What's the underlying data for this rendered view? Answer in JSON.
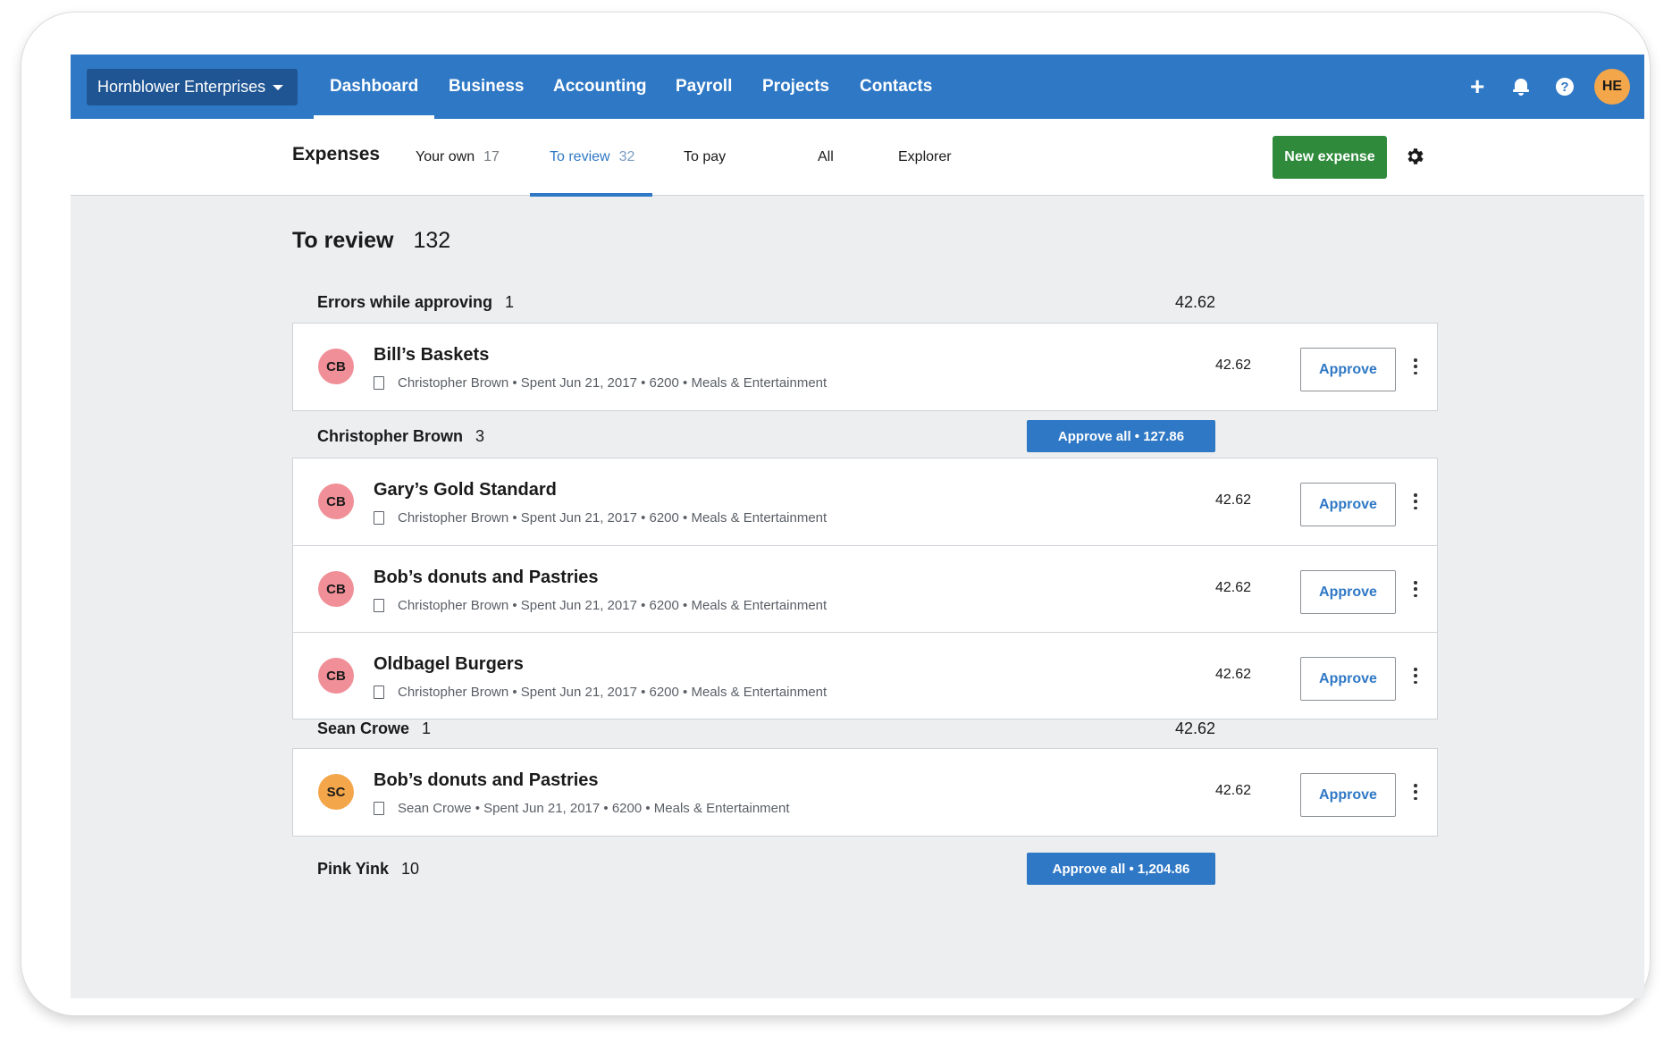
{
  "colors": {
    "nav_bg": "#2f78c5",
    "org_bg": "#1f5593",
    "primary": "#2f78c5",
    "success": "#2f8a3b",
    "avatar_cb": "#f08f97",
    "avatar_sc": "#f4a64a",
    "avatar_he": "#f4a64a"
  },
  "topnav": {
    "org_name": "Hornblower Enterprises",
    "items": [
      {
        "label": "Dashboard",
        "active": true
      },
      {
        "label": "Business"
      },
      {
        "label": "Accounting"
      },
      {
        "label": "Payroll"
      },
      {
        "label": "Projects"
      },
      {
        "label": "Contacts"
      }
    ],
    "icons": [
      "plus-icon",
      "bell-icon",
      "help-icon"
    ],
    "help_glyph": "?",
    "plus_glyph": "+",
    "user_initials": "HE"
  },
  "subnav": {
    "title": "Expenses",
    "tabs": [
      {
        "label": "Your own",
        "count": "17"
      },
      {
        "label": "To review",
        "count": "32",
        "active": true
      },
      {
        "label": "To pay",
        "count": ""
      },
      {
        "label": "All",
        "count": ""
      },
      {
        "label": "Explorer",
        "count": ""
      }
    ],
    "new_expense_label": "New expense"
  },
  "main": {
    "heading": "To review",
    "heading_count": "132",
    "groups": [
      {
        "title": "Errors while approving",
        "count": "1",
        "total": "42.62",
        "rows": [
          {
            "initials": "CB",
            "name": "Bill’s Baskets",
            "meta": "Christopher Brown • Spent Jun 21, 2017 • 6200 • Meals & Entertainment",
            "amount": "42.62",
            "action": "Approve"
          }
        ]
      },
      {
        "title": "Christopher Brown",
        "count": "3",
        "approve_all": "Approve all • 127.86",
        "rows": [
          {
            "initials": "CB",
            "name": "Gary’s Gold Standard",
            "meta": "Christopher Brown • Spent Jun 21, 2017 • 6200 • Meals & Entertainment",
            "amount": "42.62",
            "action": "Approve"
          },
          {
            "initials": "CB",
            "name": "Bob’s donuts and Pastries",
            "meta": "Christopher Brown • Spent Jun 21, 2017 • 6200 • Meals & Entertainment",
            "amount": "42.62",
            "action": "Approve"
          },
          {
            "initials": "CB",
            "name": "Oldbagel Burgers",
            "meta": "Christopher Brown • Spent Jun 21, 2017 • 6200 • Meals & Entertainment",
            "amount": "42.62",
            "action": "Approve"
          }
        ]
      },
      {
        "title": "Sean Crowe",
        "count": "1",
        "total": "42.62",
        "rows": [
          {
            "initials": "SC",
            "name": "Bob’s donuts and Pastries",
            "meta": "Sean Crowe • Spent Jun 21, 2017 • 6200 • Meals & Entertainment",
            "amount": "42.62",
            "action": "Approve"
          }
        ]
      },
      {
        "title": "Pink Yink",
        "count": "10",
        "approve_all": "Approve all • 1,204.86"
      }
    ]
  }
}
